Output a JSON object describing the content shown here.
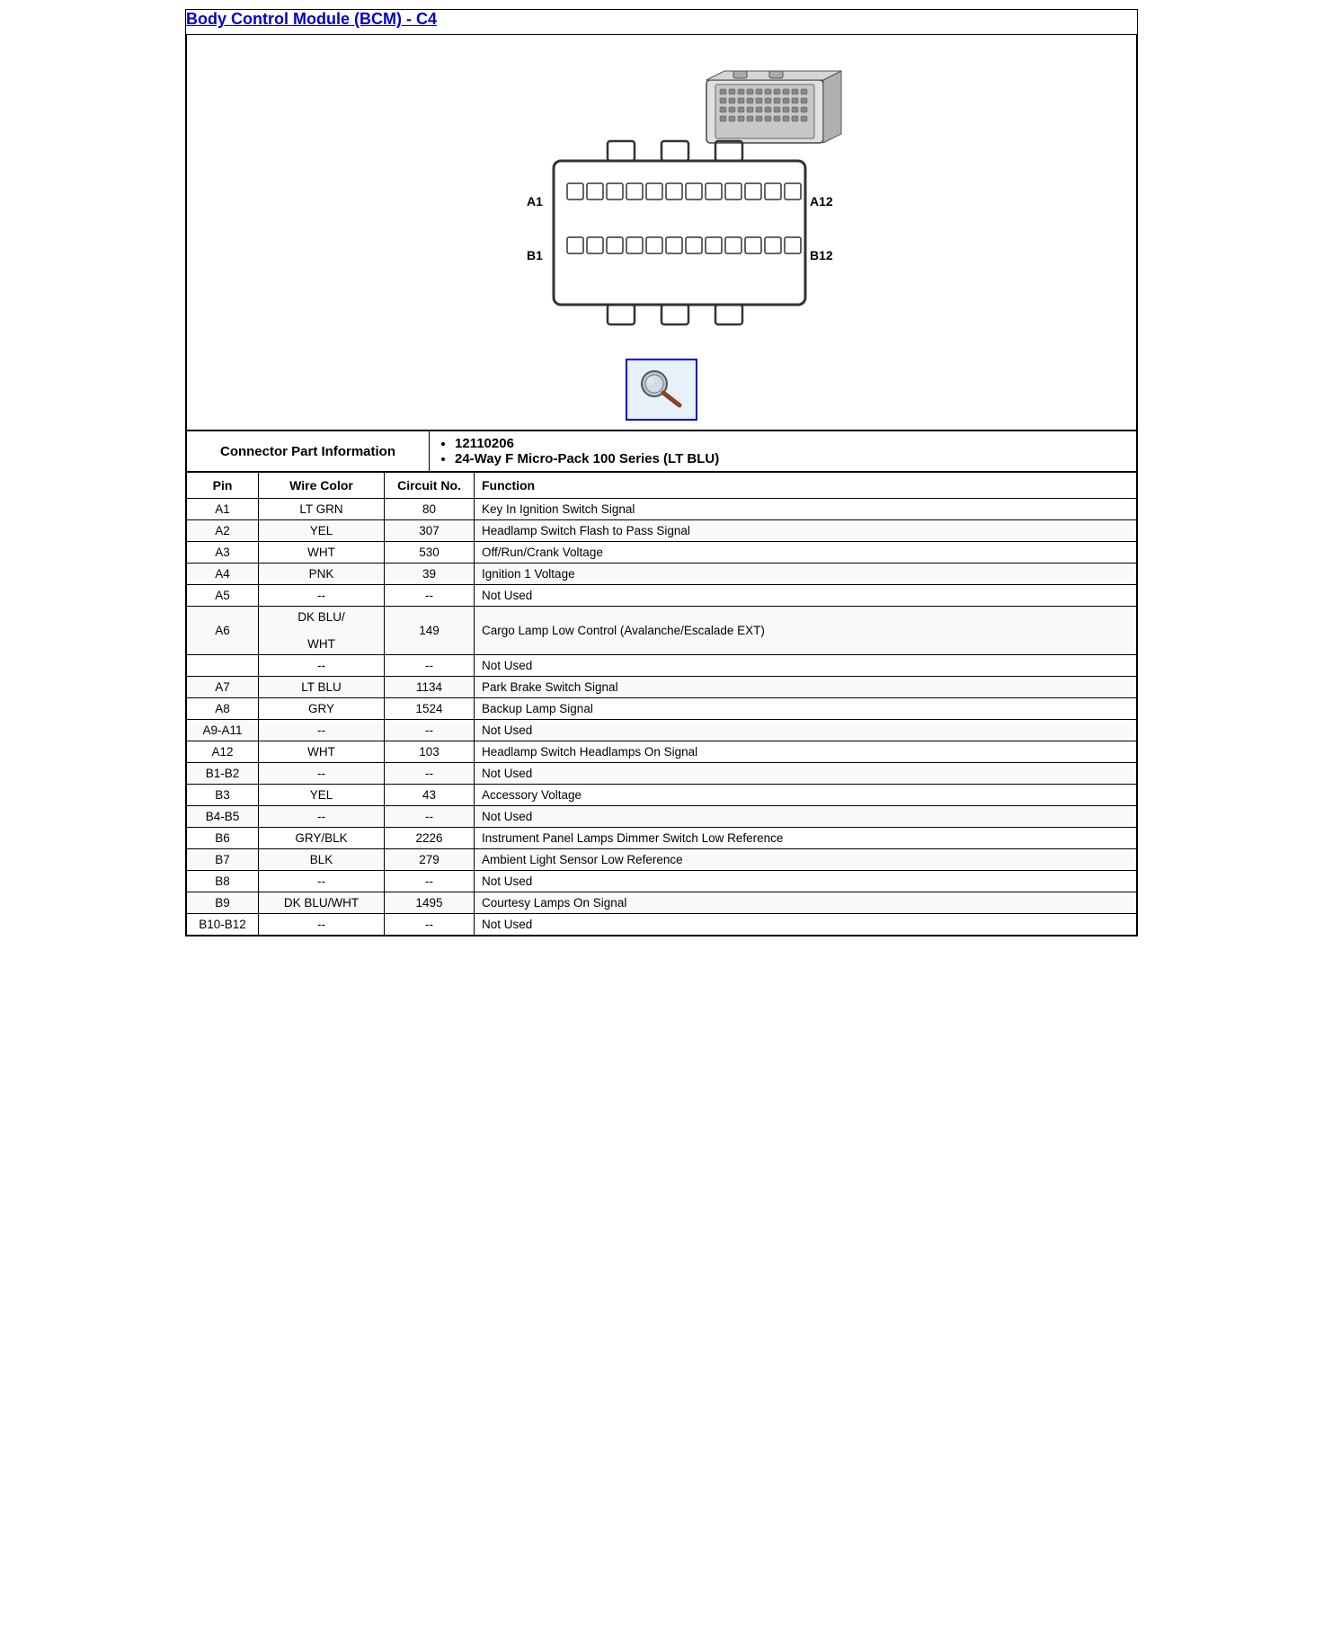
{
  "title": "Body Control Module (BCM) - C4",
  "connector_part": {
    "label": "Connector Part Information",
    "info_items": [
      "12110206",
      "24-Way F Micro-Pack 100 Series (LT BLU)"
    ]
  },
  "table_headers": {
    "pin": "Pin",
    "wire_color": "Wire Color",
    "circuit_no": "Circuit No.",
    "function": "Function"
  },
  "pins": [
    {
      "pin": "A1",
      "wire_color": "LT GRN",
      "circuit_no": "80",
      "function": "Key In Ignition Switch Signal"
    },
    {
      "pin": "A2",
      "wire_color": "YEL",
      "circuit_no": "307",
      "function": "Headlamp Switch Flash to Pass Signal"
    },
    {
      "pin": "A3",
      "wire_color": "WHT",
      "circuit_no": "530",
      "function": "Off/Run/Crank Voltage"
    },
    {
      "pin": "A4",
      "wire_color": "PNK",
      "circuit_no": "39",
      "function": "Ignition 1 Voltage"
    },
    {
      "pin": "A5",
      "wire_color": "--",
      "circuit_no": "--",
      "function": "Not Used"
    },
    {
      "pin": "A6",
      "wire_color": "DK BLU/\n\nWHT",
      "circuit_no": "149",
      "function": "Cargo Lamp Low Control (Avalanche/Escalade EXT)"
    },
    {
      "pin": "",
      "wire_color": "--",
      "circuit_no": "--",
      "function": "Not Used"
    },
    {
      "pin": "A7",
      "wire_color": "LT BLU",
      "circuit_no": "1134",
      "function": "Park Brake Switch Signal"
    },
    {
      "pin": "A8",
      "wire_color": "GRY",
      "circuit_no": "1524",
      "function": "Backup Lamp Signal"
    },
    {
      "pin": "A9-A11",
      "wire_color": "--",
      "circuit_no": "--",
      "function": "Not Used"
    },
    {
      "pin": "A12",
      "wire_color": "WHT",
      "circuit_no": "103",
      "function": "Headlamp Switch Headlamps On Signal"
    },
    {
      "pin": "B1-B2",
      "wire_color": "--",
      "circuit_no": "--",
      "function": "Not Used"
    },
    {
      "pin": "B3",
      "wire_color": "YEL",
      "circuit_no": "43",
      "function": "Accessory Voltage"
    },
    {
      "pin": "B4-B5",
      "wire_color": "--",
      "circuit_no": "--",
      "function": "Not Used"
    },
    {
      "pin": "B6",
      "wire_color": "GRY/BLK",
      "circuit_no": "2226",
      "function": "Instrument Panel Lamps Dimmer Switch Low Reference"
    },
    {
      "pin": "B7",
      "wire_color": "BLK",
      "circuit_no": "279",
      "function": "Ambient Light Sensor Low Reference"
    },
    {
      "pin": "B8",
      "wire_color": "--",
      "circuit_no": "--",
      "function": "Not Used"
    },
    {
      "pin": "B9",
      "wire_color": "DK BLU/WHT",
      "circuit_no": "1495",
      "function": "Courtesy Lamps On Signal"
    },
    {
      "pin": "B10-B12",
      "wire_color": "--",
      "circuit_no": "--",
      "function": "Not Used"
    }
  ]
}
